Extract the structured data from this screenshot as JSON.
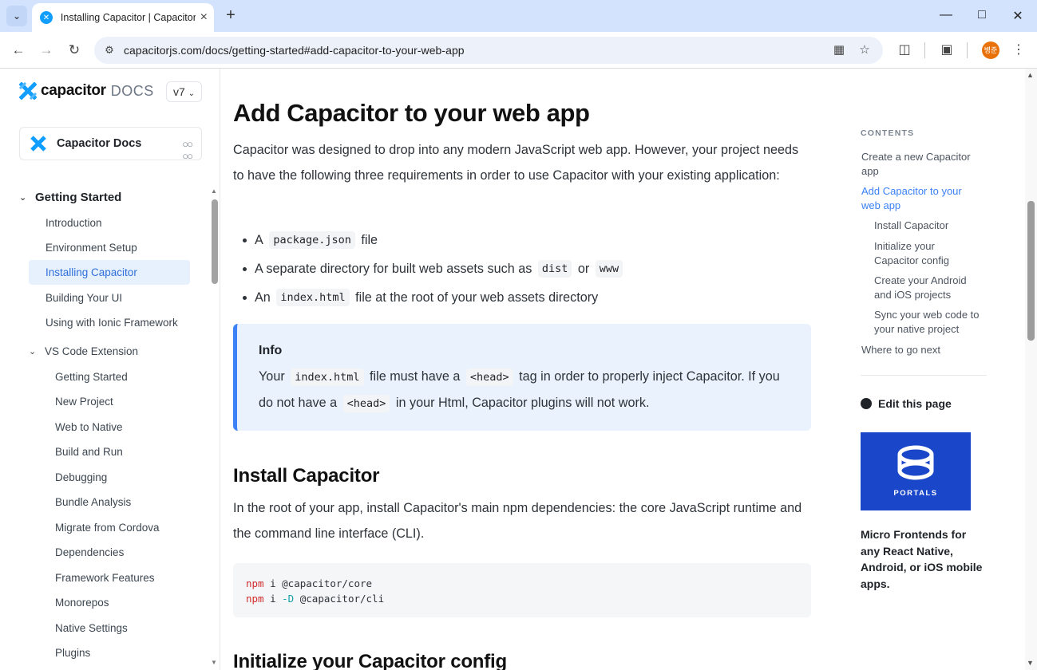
{
  "browser": {
    "tab_title": "Installing Capacitor | Capacitor",
    "url": "capacitorjs.com/docs/getting-started#add-capacitor-to-your-web-app",
    "profile_initials": "병준"
  },
  "sidebar": {
    "logo_word": "capacitor",
    "logo_docs": "DOCS",
    "version": "v7",
    "docs_card_label": "Capacitor Docs",
    "section_title": "Getting Started",
    "items": [
      {
        "label": "Introduction"
      },
      {
        "label": "Environment Setup"
      },
      {
        "label": "Installing Capacitor",
        "active": true
      },
      {
        "label": "Building Your UI"
      },
      {
        "label": "Using with Ionic Framework"
      }
    ],
    "subsection_title": "VS Code Extension",
    "subitems": [
      {
        "label": "Getting Started"
      },
      {
        "label": "New Project"
      },
      {
        "label": "Web to Native"
      },
      {
        "label": "Build and Run"
      },
      {
        "label": "Debugging"
      },
      {
        "label": "Bundle Analysis"
      },
      {
        "label": "Migrate from Cordova"
      },
      {
        "label": "Dependencies"
      },
      {
        "label": "Framework Features"
      },
      {
        "label": "Monorepos"
      },
      {
        "label": "Native Settings"
      },
      {
        "label": "Plugins"
      }
    ]
  },
  "main": {
    "title": "Add Capacitor to your web app",
    "intro": "Capacitor was designed to drop into any modern JavaScript web app. However, your project needs to have the following three requirements in order to use Capacitor with your existing application:",
    "bullets": [
      {
        "pre": "A",
        "code": "package.json",
        "post": "file"
      },
      {
        "pre": "A separate directory for built web assets such as",
        "code": "dist",
        "mid": "or",
        "code2": "www"
      },
      {
        "pre": "An",
        "code": "index.html",
        "post": "file at the root of your web assets directory"
      }
    ],
    "info": {
      "title": "Info",
      "line1_pre": "Your",
      "line1_code": "index.html",
      "line1_mid": "file must have a",
      "line1_code2": "<head>",
      "line1_post": "tag in order to properly inject Capacitor. If you",
      "line2_pre": "do not have a",
      "line2_code": "<head>",
      "line2_post": "in your Html, Capacitor plugins will not work."
    },
    "install_heading": "Install Capacitor",
    "install_text": "In the root of your app, install Capacitor's main npm dependencies: the core JavaScript runtime and the command line interface (CLI).",
    "code_lines": [
      {
        "cmd": "npm",
        "rest": " i @capacitor/core"
      },
      {
        "cmd": "npm",
        "rest": " i ",
        "flag": "-D",
        "rest2": " @capacitor/cli"
      }
    ],
    "next_heading": "Initialize your Capacitor config"
  },
  "toc": {
    "heading": "CONTENTS",
    "items": [
      {
        "label": "Create a new Capacitor app"
      },
      {
        "label": "Add Capacitor to your web app",
        "active": true
      },
      {
        "label": "Install Capacitor",
        "indent": true
      },
      {
        "label": "Initialize your Capacitor config",
        "indent": true
      },
      {
        "label": "Create your Android and iOS projects",
        "indent": true
      },
      {
        "label": "Sync your web code to your native project",
        "indent": true
      },
      {
        "label": "Where to go next"
      }
    ],
    "edit_label": "Edit this page",
    "promo_image_label": "PORTALS",
    "promo_text": "Micro Frontends for any React Native, Android, or iOS mobile apps."
  },
  "colors": {
    "accent": "#3c82f6",
    "active_bg": "#e7f1fe",
    "info_bg": "#eaf2fd",
    "portals_bg": "#1a47c9"
  }
}
